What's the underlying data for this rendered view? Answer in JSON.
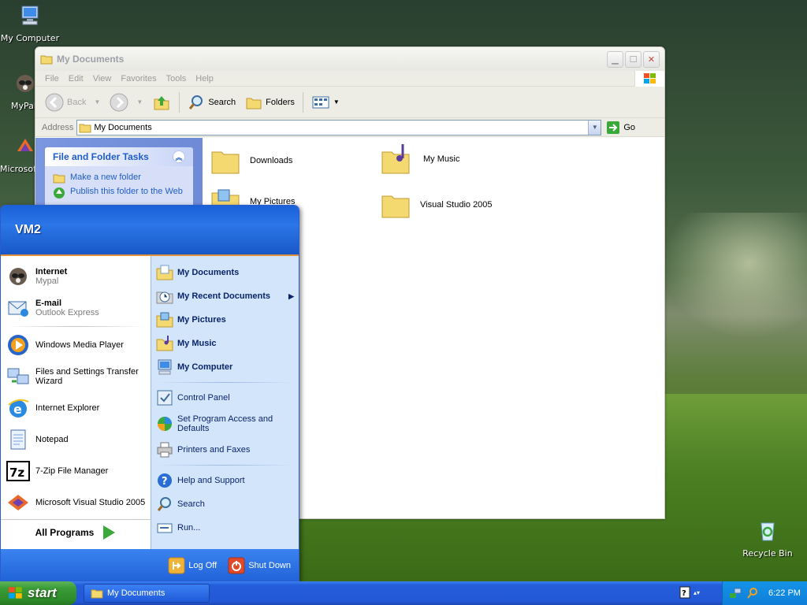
{
  "desktop": {
    "icons": [
      {
        "label": "My Computer"
      },
      {
        "label": "MyPal"
      },
      {
        "label": "Microsoft Visual Studio 2005"
      },
      {
        "label": "Recycle Bin"
      }
    ]
  },
  "window": {
    "title": "My Documents",
    "menu": [
      "File",
      "Edit",
      "View",
      "Favorites",
      "Tools",
      "Help"
    ],
    "toolbar": {
      "back": "Back",
      "search": "Search",
      "folders": "Folders"
    },
    "address": {
      "label": "Address",
      "value": "My Documents",
      "go": "Go"
    },
    "taskpane": {
      "title": "File and Folder Tasks",
      "items": [
        "Make a new folder",
        "Publish this folder to the Web"
      ]
    },
    "folders": [
      "Downloads",
      "My Music",
      "My Pictures",
      "Visual Studio 2005"
    ]
  },
  "startmenu": {
    "user": "VM2",
    "pinned": [
      {
        "title": "Internet",
        "sub": "Mypal"
      },
      {
        "title": "E-mail",
        "sub": "Outlook Express"
      }
    ],
    "recent": [
      "Windows Media Player",
      "Files and Settings Transfer Wizard",
      "Internet Explorer",
      "Notepad",
      "7-Zip File Manager",
      "Microsoft Visual Studio 2005"
    ],
    "all_programs": "All Programs",
    "right": {
      "my_documents": "My Documents",
      "my_recent": "My Recent Documents",
      "my_pictures": "My Pictures",
      "my_music": "My Music",
      "my_computer": "My Computer",
      "control_panel": "Control Panel",
      "set_program": "Set Program Access and Defaults",
      "printers": "Printers and Faxes",
      "help": "Help and Support",
      "search": "Search",
      "run": "Run..."
    },
    "log_off": "Log Off",
    "shut_down": "Shut Down"
  },
  "taskbar": {
    "start": "start",
    "task": "My Documents",
    "clock": "6:22 PM"
  }
}
